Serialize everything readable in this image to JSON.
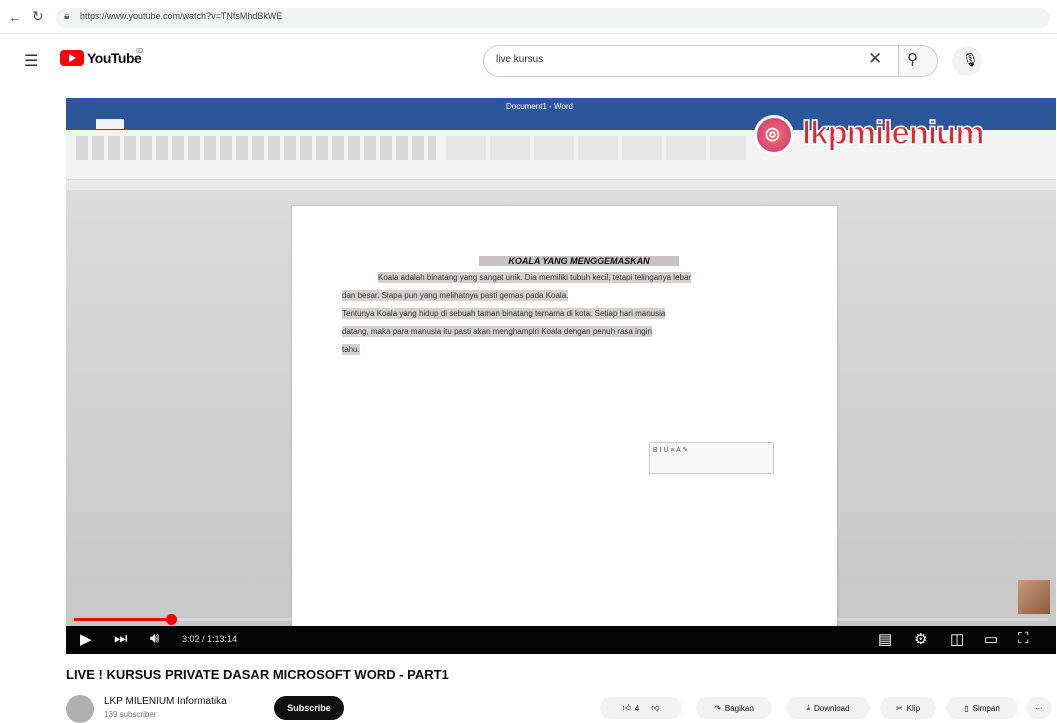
{
  "browser": {
    "url": "https://www.youtube.com/watch?v=TNfsMhdBkWE"
  },
  "header": {
    "logo_text": "YouTube",
    "country": "ID",
    "search": {
      "value": "live kursus",
      "placeholder": ""
    }
  },
  "video": {
    "word_app_title": "Document1 - Word",
    "document": {
      "title": "KOALA YANG MENGGEMASKAN",
      "lines": [
        "Koala adalah binatang yang sangat unik. Dia memiliki tubuh kecil, tetapi telinganya lebar",
        "dan besar. Siapa pun yang melihatnya pasti gemas pada Koala.",
        "Tentunya Koala yang hidup di sebuah taman binatang ternama di kota. Setiap hari manusia",
        "datang, maka para manusia itu pasti akan menghampiri Koala dengan penuh rasa ingin",
        "tahu."
      ]
    },
    "brand_text": "lkpmilenium",
    "brand_icon": "instagram-icon",
    "progress": 0.1,
    "time_text": "3:02 / 1:13:14",
    "title": "LIVE ! KURSUS PRIVATE DASAR MICROSOFT WORD - PART1"
  },
  "channel": {
    "name": "LKP MILENIUM Informatika",
    "subs": "139 subscriber",
    "subscribe_label": "Subscribe"
  },
  "actions": {
    "like_count": "4",
    "share": "Bagikan",
    "download": "Download",
    "clip": "Klip",
    "save": "Simpan",
    "more": "···"
  },
  "colors": {
    "accent": "#ff0000",
    "word_blue": "#2b579a",
    "brand_red": "#e0262c"
  }
}
